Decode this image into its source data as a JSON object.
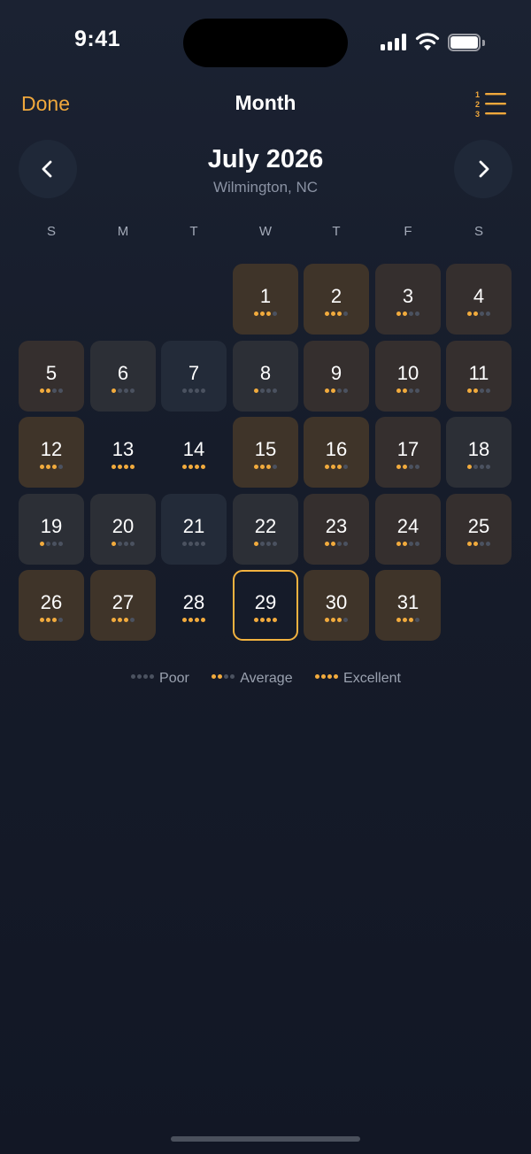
{
  "status_bar": {
    "time": "9:41"
  },
  "nav": {
    "done_label": "Done",
    "title": "Month",
    "list_icon": "numbered-list-icon"
  },
  "header": {
    "month": "July 2026",
    "location": "Wilmington, NC"
  },
  "weekdays": [
    "S",
    "M",
    "T",
    "W",
    "T",
    "F",
    "S"
  ],
  "colors": {
    "accent": "#f0a83c",
    "inactive_dot": "#4b5260",
    "today_border": "#f2b23f"
  },
  "calendar": {
    "first_weekday_index": 3,
    "selected_day": "29",
    "days": [
      {
        "day": "1",
        "rating": 3
      },
      {
        "day": "2",
        "rating": 3
      },
      {
        "day": "3",
        "rating": 2
      },
      {
        "day": "4",
        "rating": 2
      },
      {
        "day": "5",
        "rating": 2
      },
      {
        "day": "6",
        "rating": 1
      },
      {
        "day": "7",
        "rating": 0
      },
      {
        "day": "8",
        "rating": 1
      },
      {
        "day": "9",
        "rating": 2
      },
      {
        "day": "10",
        "rating": 2
      },
      {
        "day": "11",
        "rating": 2
      },
      {
        "day": "12",
        "rating": 3
      },
      {
        "day": "13",
        "rating": 4
      },
      {
        "day": "14",
        "rating": 4
      },
      {
        "day": "15",
        "rating": 3
      },
      {
        "day": "16",
        "rating": 3
      },
      {
        "day": "17",
        "rating": 2
      },
      {
        "day": "18",
        "rating": 1
      },
      {
        "day": "19",
        "rating": 1
      },
      {
        "day": "20",
        "rating": 1
      },
      {
        "day": "21",
        "rating": 0
      },
      {
        "day": "22",
        "rating": 1
      },
      {
        "day": "23",
        "rating": 2
      },
      {
        "day": "24",
        "rating": 2
      },
      {
        "day": "25",
        "rating": 2
      },
      {
        "day": "26",
        "rating": 3
      },
      {
        "day": "27",
        "rating": 3
      },
      {
        "day": "28",
        "rating": 4
      },
      {
        "day": "29",
        "rating": 4
      },
      {
        "day": "30",
        "rating": 3
      },
      {
        "day": "31",
        "rating": 3
      }
    ]
  },
  "legend": [
    {
      "label": "Poor",
      "rating": 0
    },
    {
      "label": "Average",
      "rating": 2
    },
    {
      "label": "Excellent",
      "rating": 4
    }
  ]
}
